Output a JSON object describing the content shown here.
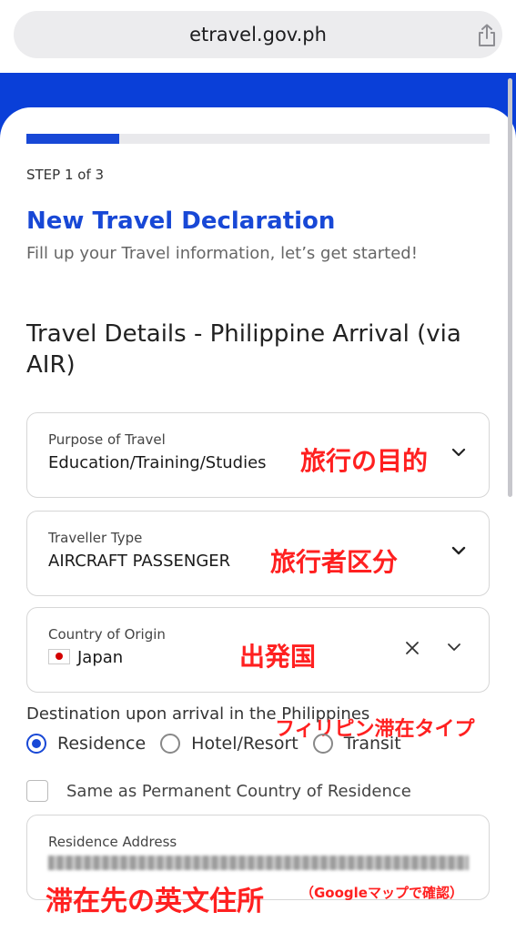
{
  "browser": {
    "url": "etravel.gov.ph"
  },
  "progress": {
    "fraction": 0.2
  },
  "step": "STEP 1 of 3",
  "title": "New Travel Declaration",
  "subtitle": "Fill up your Travel information, let’s get started!",
  "section_title": "Travel Details - Philippine Arrival (via AIR)",
  "fields": {
    "purpose": {
      "label": "Purpose of Travel",
      "value": "Education/Training/Studies",
      "note": "旅行の目的"
    },
    "traveller": {
      "label": "Traveller Type",
      "value": "AIRCRAFT PASSENGER",
      "note": "旅行者区分"
    },
    "origin": {
      "label": "Country of Origin",
      "value": "Japan",
      "note": "出発国"
    }
  },
  "destination": {
    "label": "Destination upon arrival in the Philippines",
    "note": "フィリピン滞在タイプ",
    "options": [
      "Residence",
      "Hotel/Resort",
      "Transit"
    ],
    "selected": "Residence"
  },
  "same_as_permanent": "Same as Permanent Country of Residence",
  "address": {
    "label": "Residence Address",
    "note_main": "滞在先の英文住所",
    "note_small": "（Googleマップで確認）"
  },
  "colors": {
    "brand_blue": "#1848d6",
    "annotation_red": "#ff2020"
  },
  "icons": {
    "share": "share-icon",
    "chevron": "chevron-down-icon",
    "clear": "close-icon",
    "flag": "japan-flag-icon"
  }
}
